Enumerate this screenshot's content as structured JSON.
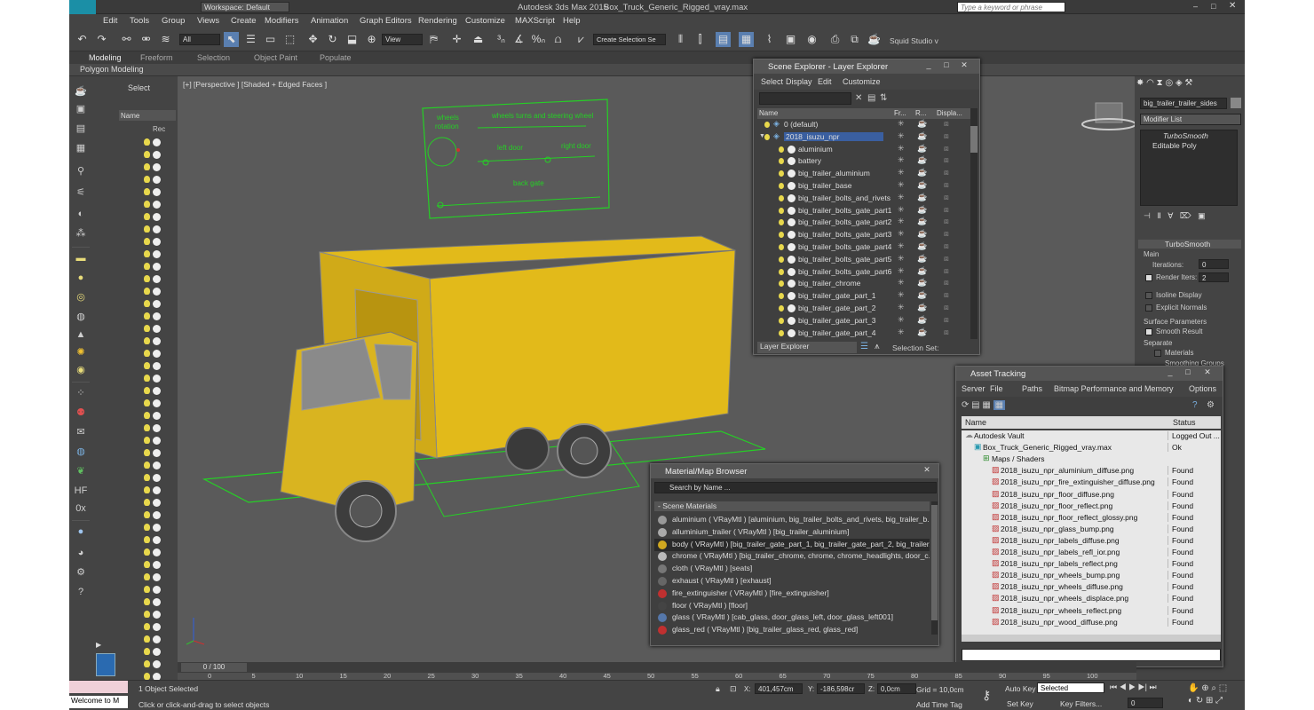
{
  "titlebar": {
    "workspace": "Workspace: Default",
    "app_title": "Autodesk 3ds Max 2015",
    "file_name": "Box_Truck_Generic_Rigged_vray.max",
    "search_placeholder": "Type a keyword or phrase"
  },
  "menu": [
    "Edit",
    "Tools",
    "Group",
    "Views",
    "Create",
    "Modifiers",
    "Animation",
    "Graph Editors",
    "Rendering",
    "Customize",
    "MAXScript",
    "Help"
  ],
  "toolbar": {
    "selection_filter": "All",
    "view": "View",
    "named_selection": "Create Selection Se",
    "studio": "Squid Studio v"
  },
  "ribbon": {
    "tabs": [
      "Modeling",
      "Freeform",
      "Selection",
      "Object Paint",
      "Populate"
    ],
    "sub": "Polygon Modeling"
  },
  "scene_panel": {
    "select": "Select",
    "name_col": "Name",
    "root": "Rec"
  },
  "viewport": {
    "label": "[+] [Perspective ] [Shaded + Edged Faces ]",
    "rig_labels": {
      "wheels": "wheels",
      "rotation": "rotation",
      "turns": "wheels turns and steering wheel",
      "left_door": "left door",
      "right_door": "right door",
      "back_gate": "back gate"
    }
  },
  "scene_explorer": {
    "title": "Scene Explorer - Layer Explorer",
    "menu": [
      "Select",
      "Display",
      "Edit",
      "Customize"
    ],
    "columns": [
      "Name",
      "Fr...",
      "R...",
      "Displa..."
    ],
    "rows": [
      "0 (default)",
      "2018_isuzu_npr",
      "aluminium",
      "battery",
      "big_trailer_aluminium",
      "big_trailer_base",
      "big_trailer_bolts_and_rivets",
      "big_trailer_bolts_gate_part1",
      "big_trailer_bolts_gate_part2",
      "big_trailer_bolts_gate_part3",
      "big_trailer_bolts_gate_part4",
      "big_trailer_bolts_gate_part5",
      "big_trailer_bolts_gate_part6",
      "big_trailer_chrome",
      "big_trailer_gate_part_1",
      "big_trailer_gate_part_2",
      "big_trailer_gate_part_3",
      "big_trailer_gate_part_4"
    ],
    "footer_left": "Layer Explorer",
    "footer_right": "Selection Set:"
  },
  "material_browser": {
    "title": "Material/Map Browser",
    "search": "Search by Name ...",
    "section": "- Scene Materials",
    "items": [
      "aluminium  ( VRayMtl ) [aluminium, big_trailer_bolts_and_rivets, big_trailer_b...",
      "alluminium_trailer  ( VRayMtl ) [big_trailer_aluminium]",
      "body  ( VRayMtl ) [big_trailer_gate_part_1, big_trailer_gate_part_2, big_trailer...",
      "chrome  ( VRayMtl ) [big_trailer_chrome, chrome, chrome_headlights, door_c...",
      "cloth  ( VRayMtl ) [seats]",
      "exhaust  ( VRayMtl ) [exhaust]",
      "fire_extinguisher  ( VRayMtl ) [fire_extinguisher]",
      "floor  ( VRayMtl ) [floor]",
      "glass  ( VRayMtl ) [cab_glass, door_glass_left, door_glass_left001]",
      "glass_red  ( VRayMtl ) [big_trailer_glass_red, glass_red]"
    ]
  },
  "asset_tracking": {
    "title": "Asset Tracking",
    "menu": [
      "Server",
      "File",
      "Paths",
      "Bitmap Performance and Memory",
      "Options"
    ],
    "columns": [
      "Name",
      "Status"
    ],
    "rows": [
      {
        "name": "Autodesk Vault",
        "status": "Logged Out ...",
        "indent": 0
      },
      {
        "name": "Box_Truck_Generic_Rigged_vray.max",
        "status": "Ok",
        "indent": 1
      },
      {
        "name": "Maps / Shaders",
        "status": "",
        "indent": 2
      },
      {
        "name": "2018_isuzu_npr_aluminium_diffuse.png",
        "status": "Found",
        "indent": 3
      },
      {
        "name": "2018_isuzu_npr_fire_extinguisher_diffuse.png",
        "status": "Found",
        "indent": 3
      },
      {
        "name": "2018_isuzu_npr_floor_diffuse.png",
        "status": "Found",
        "indent": 3
      },
      {
        "name": "2018_isuzu_npr_floor_reflect.png",
        "status": "Found",
        "indent": 3
      },
      {
        "name": "2018_isuzu_npr_floor_reflect_glossy.png",
        "status": "Found",
        "indent": 3
      },
      {
        "name": "2018_isuzu_npr_glass_bump.png",
        "status": "Found",
        "indent": 3
      },
      {
        "name": "2018_isuzu_npr_labels_diffuse.png",
        "status": "Found",
        "indent": 3
      },
      {
        "name": "2018_isuzu_npr_labels_refl_ior.png",
        "status": "Found",
        "indent": 3
      },
      {
        "name": "2018_isuzu_npr_labels_reflect.png",
        "status": "Found",
        "indent": 3
      },
      {
        "name": "2018_isuzu_npr_wheels_bump.png",
        "status": "Found",
        "indent": 3
      },
      {
        "name": "2018_isuzu_npr_wheels_diffuse.png",
        "status": "Found",
        "indent": 3
      },
      {
        "name": "2018_isuzu_npr_wheels_displace.png",
        "status": "Found",
        "indent": 3
      },
      {
        "name": "2018_isuzu_npr_wheels_reflect.png",
        "status": "Found",
        "indent": 3
      },
      {
        "name": "2018_isuzu_npr_wood_diffuse.png",
        "status": "Found",
        "indent": 3
      }
    ]
  },
  "command_panel": {
    "object_name": "big_trailer_trailer_sides",
    "modifier_list": "Modifier List",
    "stack": [
      "TurboSmooth",
      "Editable Poly"
    ],
    "rollout_title": "TurboSmooth",
    "main": "Main",
    "iterations_label": "Iterations:",
    "iterations": "0",
    "render_iters_label": "Render Iters:",
    "render_iters": "2",
    "isoline": "Isoline Display",
    "explicit": "Explicit Normals",
    "surface": "Surface Parameters",
    "smooth": "Smooth Result",
    "separate": "Separate",
    "materials": "Materials",
    "smoothing": "Smoothing Groups"
  },
  "timeline": {
    "frame": "0 / 100",
    "ticks": [
      "0",
      "5",
      "10",
      "15",
      "20",
      "25",
      "30",
      "35",
      "40",
      "45",
      "50",
      "55",
      "60",
      "65",
      "70",
      "75",
      "80",
      "85",
      "90",
      "95",
      "100"
    ]
  },
  "status": {
    "maxscript": "Welcome to M",
    "selected": "1 Object Selected",
    "hint": "Click or click-and-drag to select objects",
    "x": "401,457cm",
    "y": "-186,598cr",
    "z": "0,0cm",
    "grid": "Grid = 10,0cm",
    "add_time_tag": "Add Time Tag",
    "auto_key": "Auto Key",
    "set_key": "Set Key",
    "selected_drop": "Selected",
    "key_filters": "Key Filters...",
    "frame_num": "0"
  }
}
